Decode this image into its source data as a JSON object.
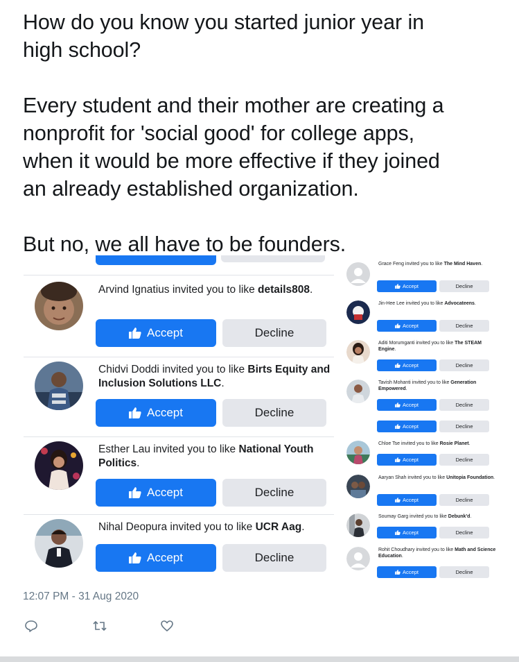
{
  "tweet": {
    "text": "How do you know you started junior year in\nhigh school?\n\nEvery student and their mother are creating a\nnonprofit for 'social good' for college apps,\nwhen it would be more effective if they joined\nan already established organization.\n\nBut no, we all have to be founders.",
    "timestamp": "12:07 PM - 31 Aug 2020"
  },
  "buttons": {
    "accept": "Accept",
    "decline": "Decline"
  },
  "invites_left": [
    {
      "name": "Arvind Ignatius",
      "action": " invited you to like ",
      "page": "details808",
      "end": "."
    },
    {
      "name": "Chidvi Doddi",
      "action": " invited you to like ",
      "page": "Birts Equity and Inclusion Solutions LLC",
      "end": "."
    },
    {
      "name": "Esther Lau",
      "action": " invited you to like ",
      "page": "National Youth Politics",
      "end": "."
    },
    {
      "name": "Nihal Deopura",
      "action": " invited you to like ",
      "page": "UCR Aag",
      "end": "."
    }
  ],
  "invites_right": [
    {
      "name": "Grace Feng",
      "action": " invited you to like ",
      "page": "The Mind Haven",
      "end": "."
    },
    {
      "name": "Jin-Hee Lee",
      "action": " invited you to like ",
      "page": "Advocateens",
      "end": "."
    },
    {
      "name": "Aditi Morumganti",
      "action": " invited you to like ",
      "page": "The STEAM Engine",
      "end": "."
    },
    {
      "name": "Tavish Mohanti",
      "action": " invited you to like ",
      "page": "Generation Empowered",
      "end": "."
    },
    {
      "name": "Chloe Tse",
      "action": " invited you to like ",
      "page": "Rosie Planet",
      "end": "."
    },
    {
      "name": "Aaryan Shah",
      "action": " invited you to like ",
      "page": "Unitopia Foundation",
      "end": "."
    },
    {
      "name": "Soumay Garg",
      "action": " invited you to like ",
      "page": "Debunk'd",
      "end": "."
    },
    {
      "name": "Rohit Choudhary",
      "action": " invited you to like ",
      "page": "Math and Science Education",
      "end": "."
    }
  ],
  "icons": {
    "accept": "thumbs-up-icon",
    "reply": "reply-icon",
    "retweet": "retweet-icon",
    "like": "heart-icon"
  },
  "colors": {
    "accept_blue": "#1877f2",
    "decline_grey": "#e4e6eb",
    "meta_grey": "#657786"
  }
}
